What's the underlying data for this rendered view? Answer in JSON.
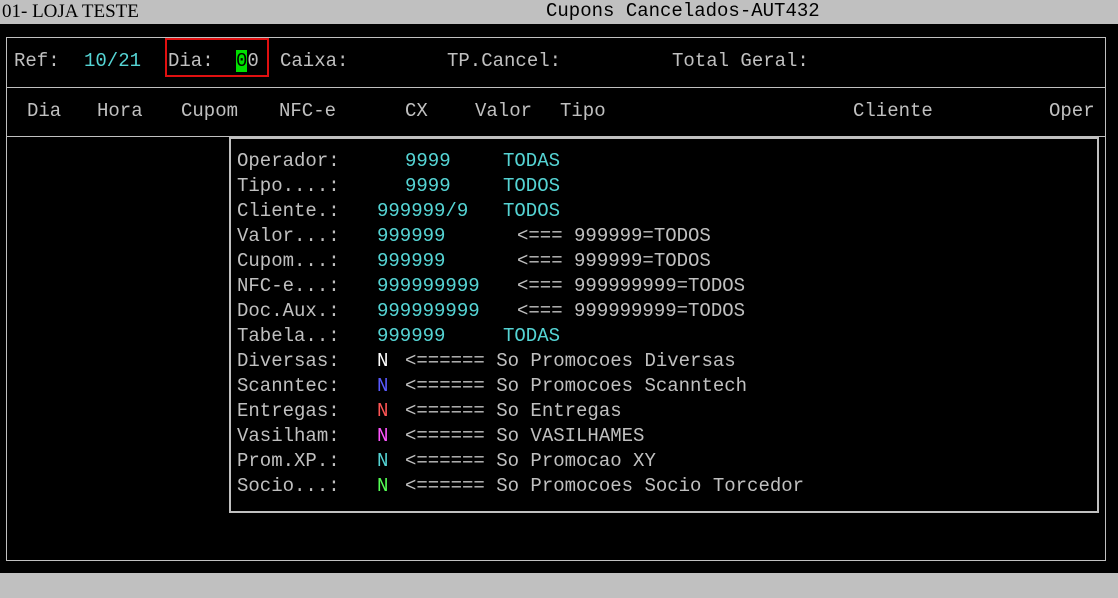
{
  "titlebar": {
    "store": "01- LOJA TESTE",
    "title": "Cupons Cancelados-AUT432"
  },
  "header": {
    "ref_label": "Ref:",
    "ref_value": "10/21",
    "dia_label": "Dia:",
    "dia_value_cursor": "0",
    "dia_value_rest": "0",
    "caixa_label": "Caixa:",
    "tpcancel_label": "TP.Cancel:",
    "total_label": "Total Geral:"
  },
  "columns": [
    "Dia",
    "Hora",
    "Cupom",
    "NFC-e",
    "CX",
    "Valor",
    "Tipo",
    "Cliente",
    "Oper"
  ],
  "filters": [
    {
      "label": "Operador:",
      "value": "9999",
      "desc": "TODAS"
    },
    {
      "label": "Tipo....:",
      "value": "9999",
      "desc": "TODOS"
    },
    {
      "label": "Cliente.:",
      "value": "999999/9",
      "desc": "TODOS"
    },
    {
      "label": "Valor...:",
      "value": "999999",
      "desc": "<=== 999999=TODOS"
    },
    {
      "label": "Cupom...:",
      "value": "999999",
      "desc": "<=== 999999=TODOS"
    },
    {
      "label": "NFC-e...:",
      "value": "999999999",
      "desc": "<=== 999999999=TODOS"
    },
    {
      "label": "Doc.Aux.:",
      "value": "999999999",
      "desc": "<=== 999999999=TODOS"
    },
    {
      "label": "Tabela..:",
      "value": "999999",
      "desc": "TODAS"
    }
  ],
  "flags": [
    {
      "label": "Diversas:",
      "value": "N",
      "desc": "<====== So Promocoes Diversas"
    },
    {
      "label": "Scanntec:",
      "value": "N",
      "desc": "<====== So Promocoes Scanntech"
    },
    {
      "label": "Entregas:",
      "value": "N",
      "desc": "<====== So Entregas"
    },
    {
      "label": "Vasilham:",
      "value": "N",
      "desc": "<====== So VASILHAMES"
    },
    {
      "label": "Prom.XP.:",
      "value": "N",
      "desc": "<====== So Promocao XY"
    },
    {
      "label": "Socio...:",
      "value": "N",
      "desc": "<====== So Promocoes Socio Torcedor"
    }
  ],
  "colors": {
    "label": "#c0c0c0",
    "value": "#55d4d4",
    "flag_diversas": "#ffffff",
    "flag_scanntec": "#5a5aff",
    "flag_entregas": "#ff5555",
    "flag_vasilham": "#ff55ff",
    "flag_promxp": "#55d4d4",
    "flag_socio": "#55ff55",
    "cursor": "#00e000",
    "highlight_box": "#e01010"
  }
}
